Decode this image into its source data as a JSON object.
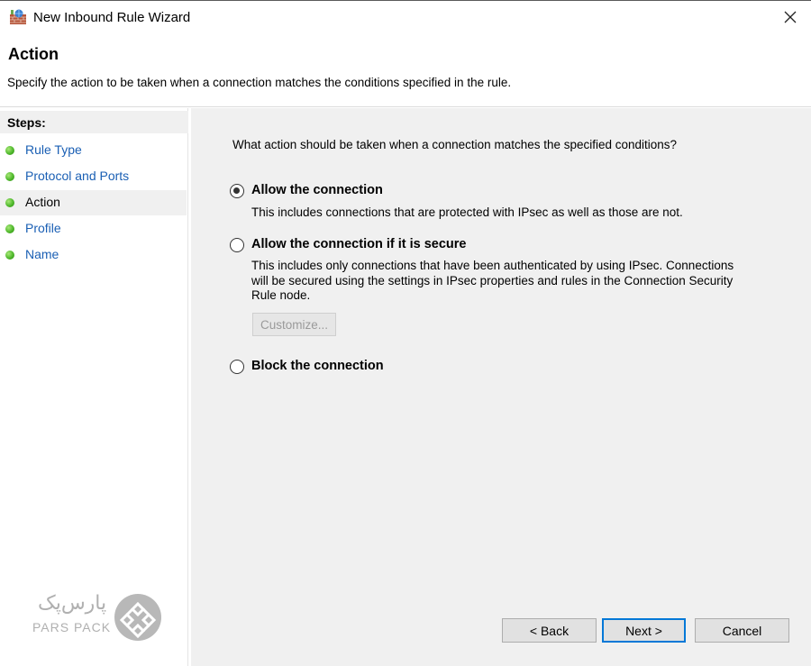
{
  "window": {
    "title": "New Inbound Rule Wizard",
    "close_symbol": "✕"
  },
  "header": {
    "title": "Action",
    "subtitle": "Specify the action to be taken when a connection matches the conditions specified in the rule."
  },
  "steps": {
    "heading": "Steps:",
    "items": [
      {
        "label": "Rule Type",
        "active": false
      },
      {
        "label": "Protocol and Ports",
        "active": false
      },
      {
        "label": "Action",
        "active": true
      },
      {
        "label": "Profile",
        "active": false
      },
      {
        "label": "Name",
        "active": false
      }
    ]
  },
  "main": {
    "question": "What action should be taken when a connection matches the specified conditions?",
    "options": [
      {
        "label": "Allow the connection",
        "description": "This includes connections that are protected with IPsec as well as those are not.",
        "checked": true
      },
      {
        "label": "Allow the connection if it is secure",
        "description_lines": [
          "This includes only connections that have been authenticated by using IPsec.  Connections",
          "will be secured using the settings in IPsec properties and rules in the Connection Security",
          "Rule node."
        ],
        "checked": false
      },
      {
        "label": "Block the connection",
        "checked": false
      }
    ],
    "customize_label": "Customize..."
  },
  "footer": {
    "back_label": "< Back",
    "next_label": "Next >",
    "cancel_label": "Cancel"
  },
  "watermark": {
    "text_fa": "پارس‌پک",
    "text_en": "PARS PACK"
  },
  "colors": {
    "link": "#1a5fb4",
    "accent": "#0078d7",
    "content_bg": "#f0f0f0",
    "step_dot": "#4fb82c"
  }
}
